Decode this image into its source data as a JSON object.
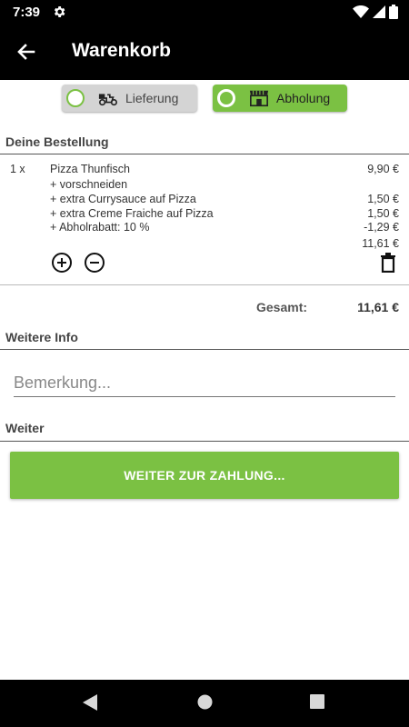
{
  "status_bar": {
    "time": "7:39"
  },
  "app_bar": {
    "title": "Warenkorb"
  },
  "delivery_toggle": {
    "delivery_label": "Lieferung",
    "pickup_label": "Abholung",
    "selected": "pickup"
  },
  "order": {
    "section_title": "Deine Bestellung",
    "items": [
      {
        "qty": "1 x",
        "name": "Pizza Thunfisch",
        "price": "9,90 €",
        "extras": [
          {
            "label": "+ vorschneiden",
            "price": ""
          },
          {
            "label": "+ extra Currysauce auf Pizza",
            "price": "1,50 €"
          },
          {
            "label": "+ extra Creme Fraiche auf Pizza",
            "price": "1,50 €"
          },
          {
            "label": "+ Abholrabatt: 10 %",
            "price": "-1,29 €"
          }
        ],
        "subtotal": "11,61 €"
      }
    ],
    "total_label": "Gesamt:",
    "total_value": "11,61 €"
  },
  "info": {
    "section_title": "Weitere Info",
    "remark_placeholder": "Bemerkung...",
    "remark_value": ""
  },
  "next": {
    "section_title": "Weiter",
    "button_label": "WEITER ZUR ZAHLUNG..."
  },
  "colors": {
    "accent": "#7bc143",
    "toggle_inactive": "#d4d4d4",
    "bar": "#000000"
  }
}
